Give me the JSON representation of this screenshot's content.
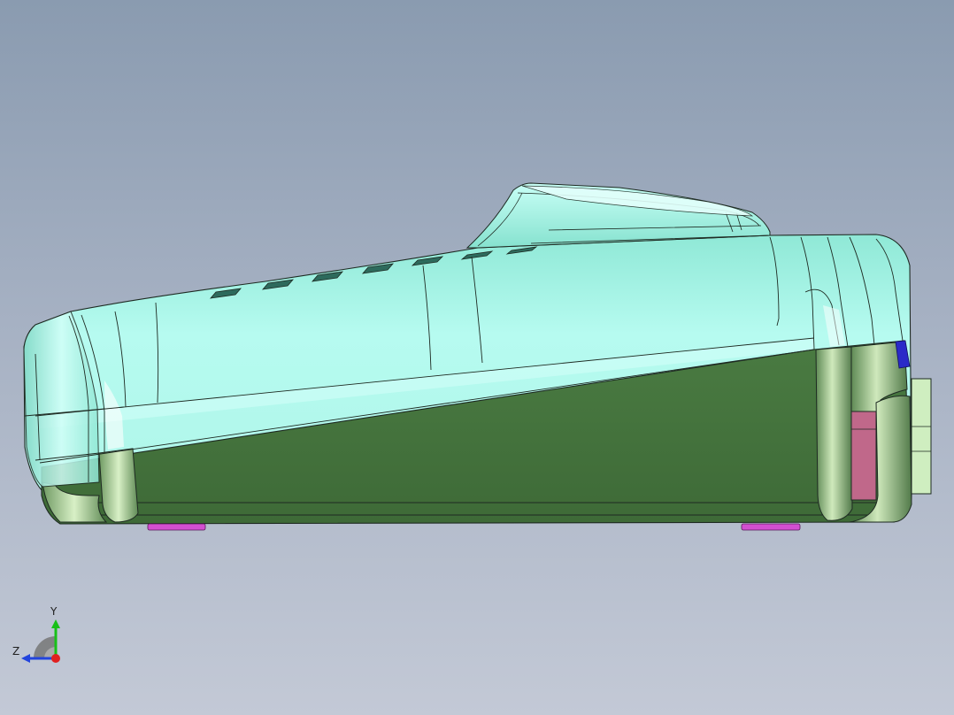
{
  "viewport": {
    "background_top": "#8a9bb0",
    "background_bottom": "#c3c9d6"
  },
  "colors": {
    "shell_light": "#aef5e8",
    "shell_highlight": "#c8fff9",
    "base_green": "#45743d",
    "edge": "#1e2a22",
    "foot_magenta": "#d24fd0",
    "port_pink": "#c0688a",
    "accent_blue": "#2a2ac8",
    "connector": "#cfeec0"
  },
  "triad": {
    "y_label": "Y",
    "z_label": "Z",
    "y_color": "#18c018",
    "z_color": "#2244dd",
    "x_color": "#e02020",
    "icon": "view-orientation-triad-icon"
  }
}
